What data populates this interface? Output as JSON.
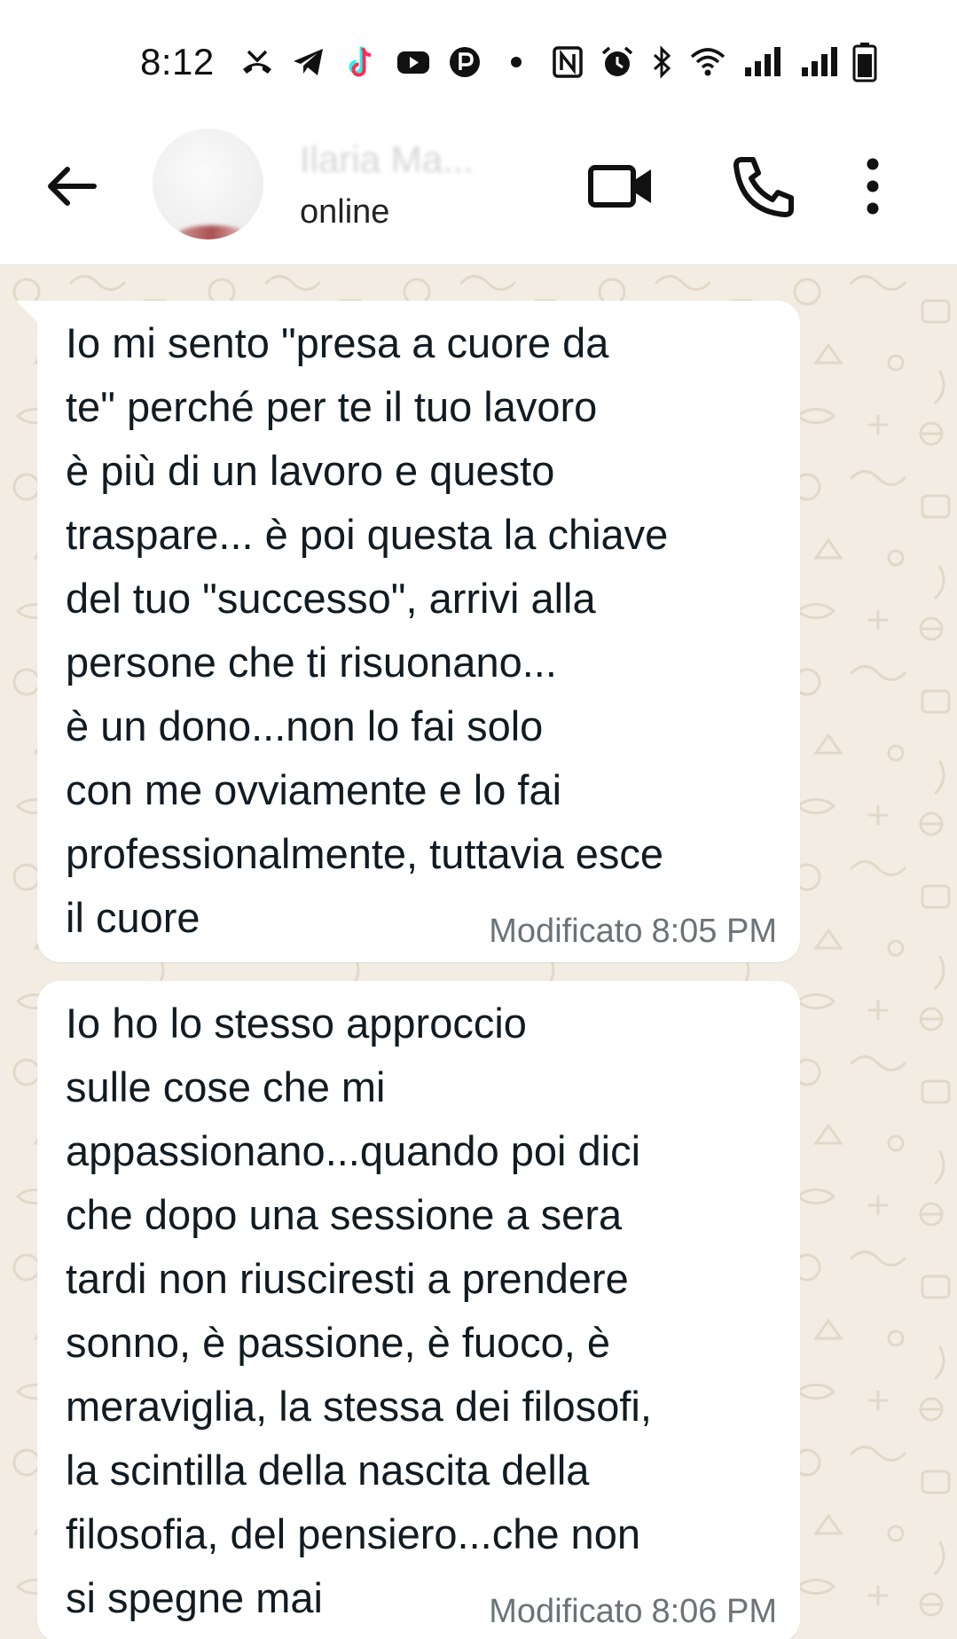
{
  "status_bar": {
    "time": "8:12",
    "icons": [
      "missed-call-icon",
      "telegram-icon",
      "tiktok-icon",
      "youtube-icon",
      "parking-icon",
      "dot-icon",
      "nfc-icon",
      "alarm-icon",
      "bluetooth-icon",
      "wifi-icon",
      "signal-icon",
      "signal-icon",
      "battery-icon"
    ]
  },
  "header": {
    "contact_name": "Ilaria Ma...",
    "status": "online",
    "icons": [
      "back-arrow-icon",
      "video-call-icon",
      "phone-icon",
      "more-vert-icon"
    ]
  },
  "colors": {
    "wallpaper": "#f2ece3",
    "bubble": "#ffffff",
    "text": "#111b21",
    "meta": "#6b7378"
  },
  "messages": [
    {
      "text": "Io mi sento \"presa a cuore da\nte\" perché per te il tuo lavoro\nè più di un lavoro e questo\ntraspare... è poi questa la chiave\ndel tuo \"successo\", arrivi alla\npersone che ti risuonano...\nè un dono...non lo fai solo\ncon me ovviamente e lo fai\nprofessionalmente, tuttavia esce\nil cuore",
      "edited_label": "Modificato",
      "time": "8:05 PM"
    },
    {
      "text": "Io ho lo stesso approccio\nsulle cose che mi\nappassionano...quando poi dici\nche dopo una sessione a sera\ntardi non riusciresti a prendere\nsonno, è passione, è fuoco, è\nmeraviglia, la stessa dei filosofi,\nla scintilla della nascita della\nfilosofia, del pensiero...che non\nsi spegne mai",
      "edited_label": "Modificato",
      "time": "8:06 PM"
    }
  ]
}
